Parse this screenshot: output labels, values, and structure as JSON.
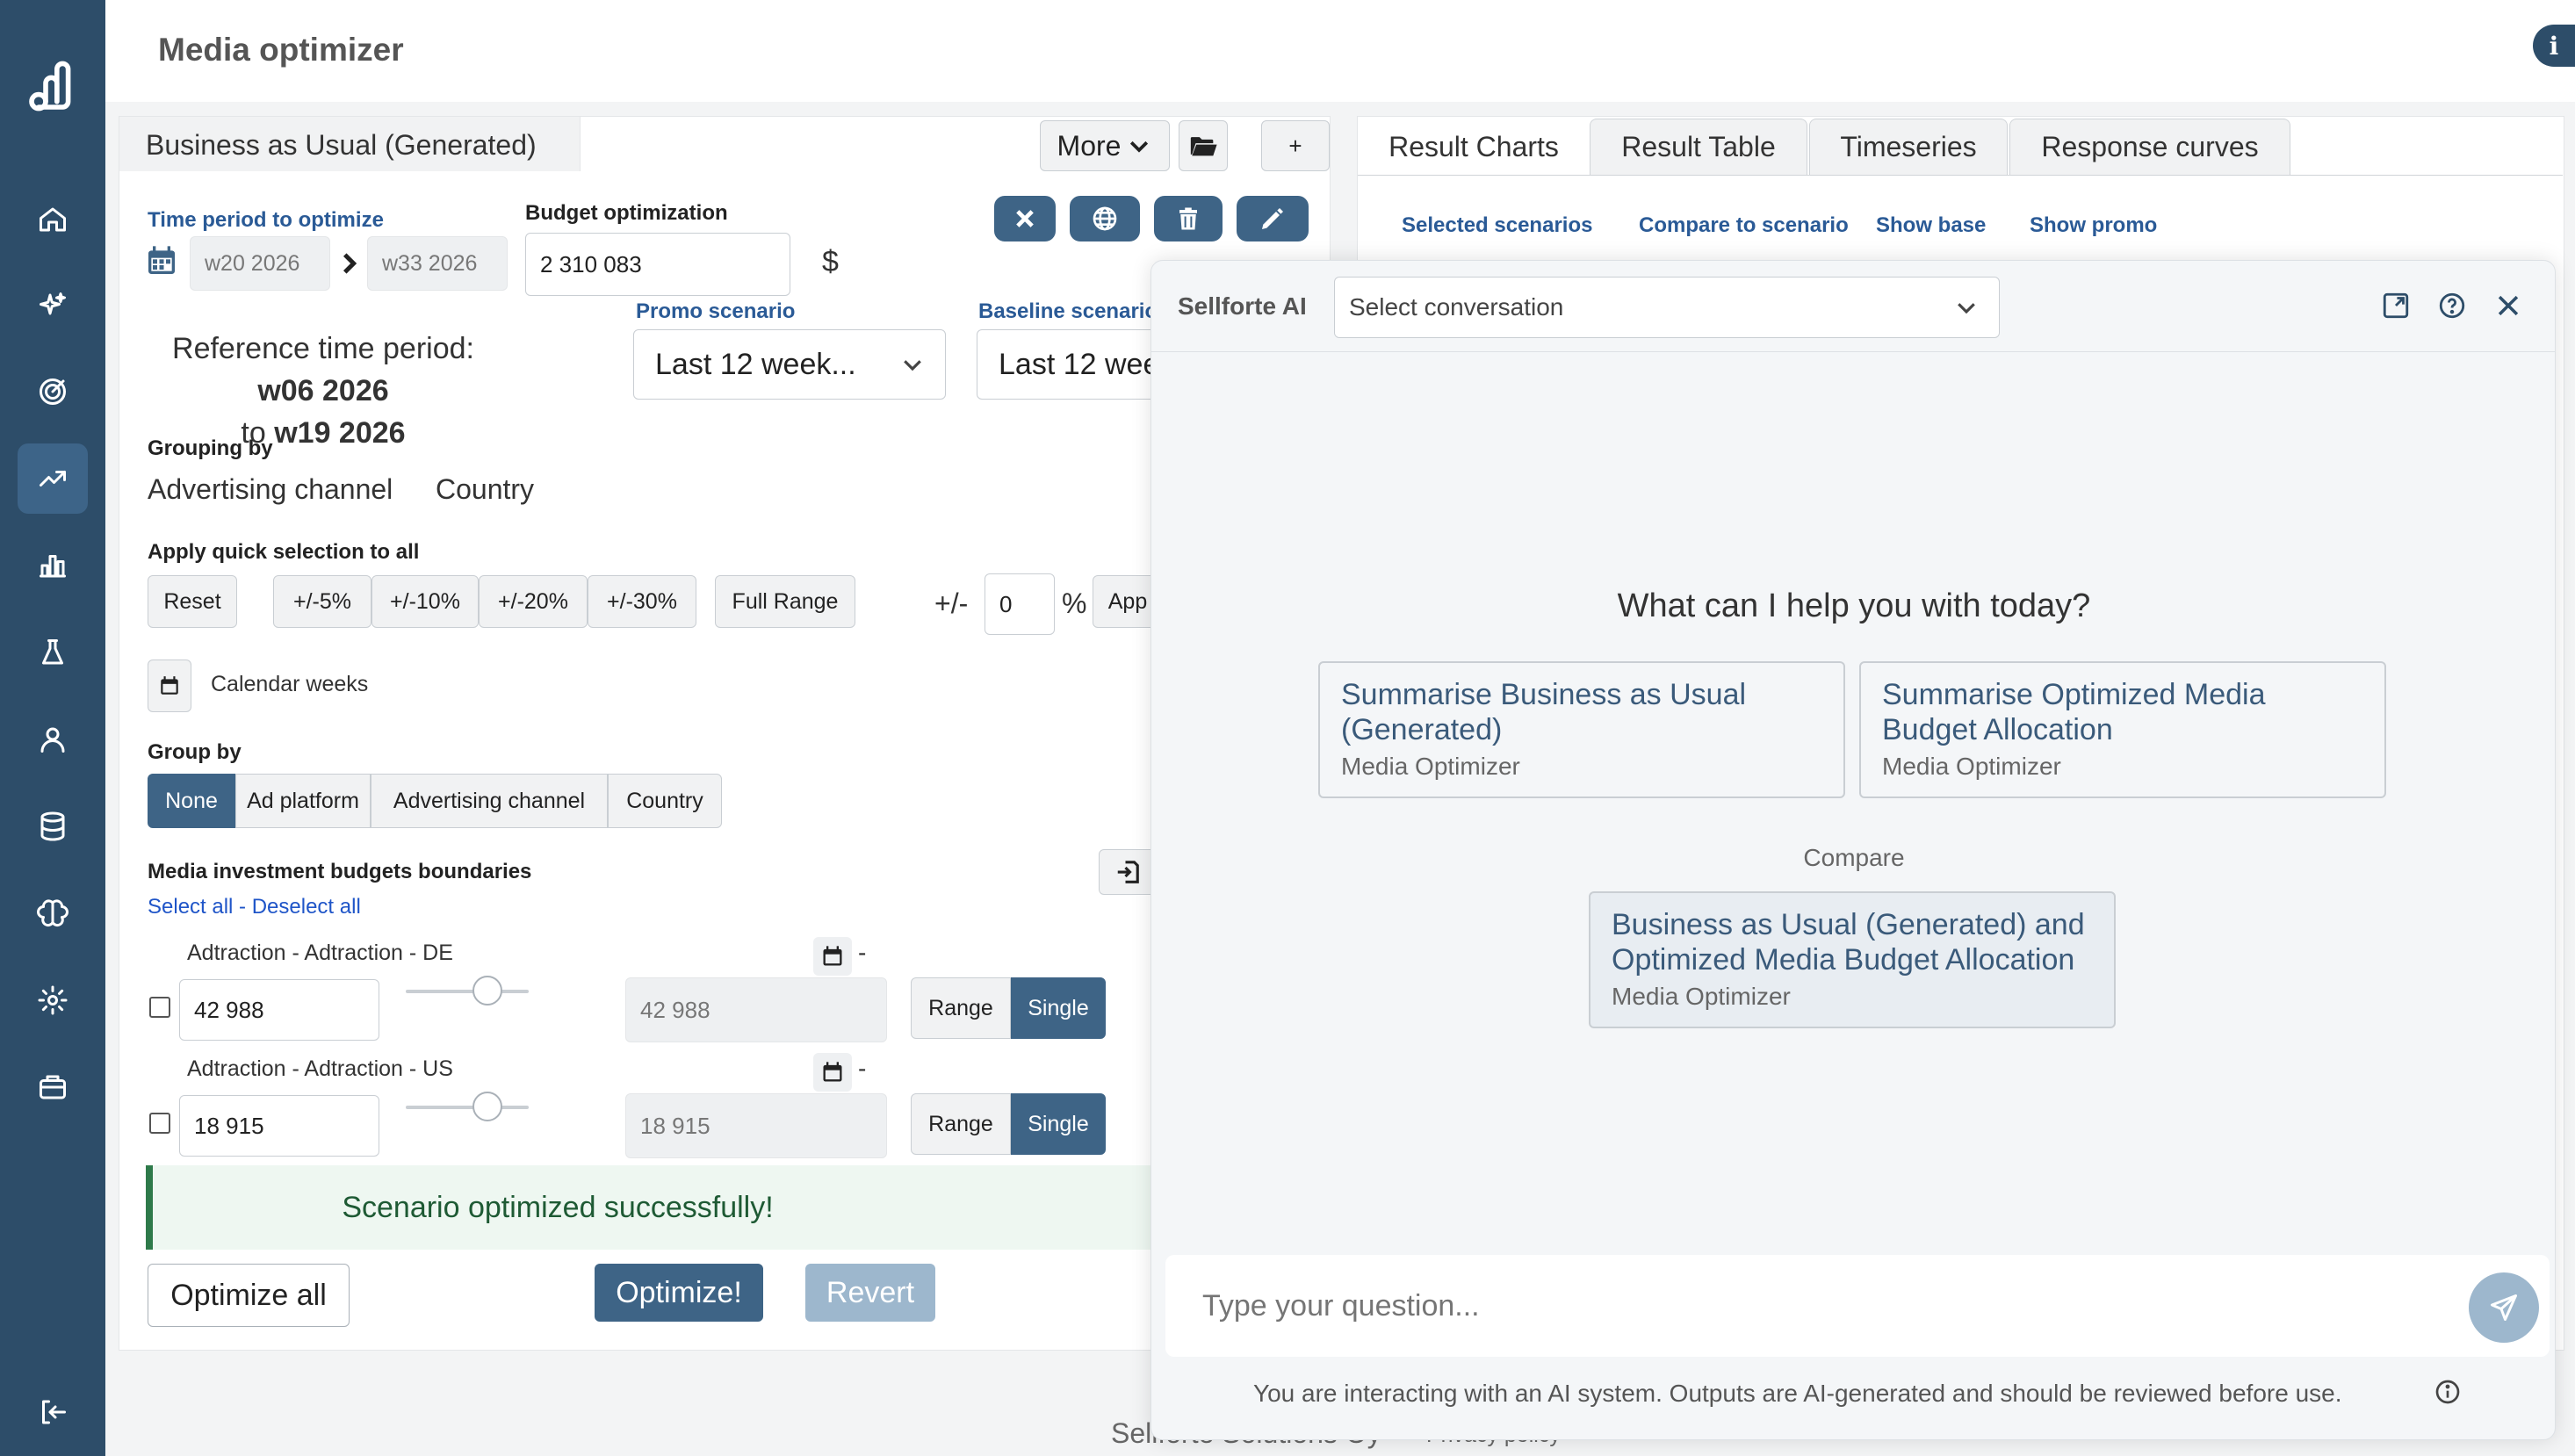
{
  "app": {
    "title": "Media optimizer"
  },
  "sidebar": {
    "items": [
      "logo",
      "home",
      "sparkle",
      "target",
      "trending",
      "bar-chart",
      "flask",
      "user",
      "database",
      "brain",
      "gear",
      "briefcase",
      "logout"
    ]
  },
  "scenario": {
    "tab_label": "Business as Usual (Generated)",
    "more_label": "More",
    "add_label": "+",
    "time_period_label": "Time period to optimize",
    "period_from": "w20 2026",
    "period_to": "w33 2026",
    "budget_label": "Budget optimization",
    "budget_value": "2 310 083",
    "currency": "$",
    "reference_prefix": "Reference time period: ",
    "reference_from": "w06 2026",
    "reference_to_word": "to",
    "reference_to": "w19 2026",
    "promo_label": "Promo scenario",
    "promo_value": "Last 12 week...",
    "baseline_label": "Baseline scenario",
    "baseline_value": "Last 12 wee",
    "grouping_label": "Grouping by",
    "grouping_values": [
      "Advertising channel",
      "Country"
    ],
    "quick_label": "Apply quick selection to all",
    "quick_buttons": [
      "Reset",
      "+/-5%",
      "+/-10%",
      "+/-20%",
      "+/-30%",
      "Full Range"
    ],
    "plusminus": "+/-",
    "pct_value": "0",
    "pct_sign": "%",
    "apply_label": "App",
    "calendar_weeks": "Calendar weeks",
    "group_by_label": "Group by",
    "group_by_options": [
      "None",
      "Ad platform",
      "Advertising channel",
      "Country"
    ],
    "boundaries_label": "Media investment budgets boundaries",
    "select_all": "Select all",
    "separator": " - ",
    "deselect_all": "Deselect all",
    "rows": [
      {
        "name": "Adtraction - Adtraction - DE",
        "value": "42 988",
        "right_value": "42 988",
        "dash": "-"
      },
      {
        "name": "Adtraction - Adtraction - US",
        "value": "18 915",
        "right_value": "18 915",
        "dash": "-"
      }
    ],
    "range_label": "Range",
    "single_label": "Single",
    "success_message": "Scenario optimized successfully!",
    "optimize_all": "Optimize all",
    "optimize": "Optimize!",
    "revert": "Revert"
  },
  "results": {
    "tabs": [
      "Result Charts",
      "Result Table",
      "Timeseries",
      "Response curves"
    ],
    "selected_label": "Selected scenarios",
    "compare_label": "Compare to scenario",
    "show_base": "Show base",
    "show_promo": "Show promo"
  },
  "ai": {
    "title": "Sellforte AI",
    "select_placeholder": "Select conversation",
    "prompt": "What can I help you with today?",
    "cards": [
      {
        "title": "Summarise Business as Usual (Generated)",
        "sub": "Media Optimizer"
      },
      {
        "title": "Summarise Optimized Media Budget Allocation",
        "sub": "Media Optimizer"
      }
    ],
    "compare_label": "Compare",
    "compare_card": {
      "title": "Business as Usual (Generated) and Optimized Media Budget Allocation",
      "sub": "Media Optimizer"
    },
    "input_placeholder": "Type your question...",
    "disclaimer": "You are interacting with an AI system. Outputs are AI-generated and should be reviewed before use."
  },
  "footer": {
    "company": "Sellforte Solutions Oy",
    "privacy": "Privacy policy"
  },
  "colors": {
    "sidebar": "#2d4d69",
    "accent": "#3e6486",
    "success_bg": "#eef7f1",
    "success_border": "#2e7a4a"
  }
}
